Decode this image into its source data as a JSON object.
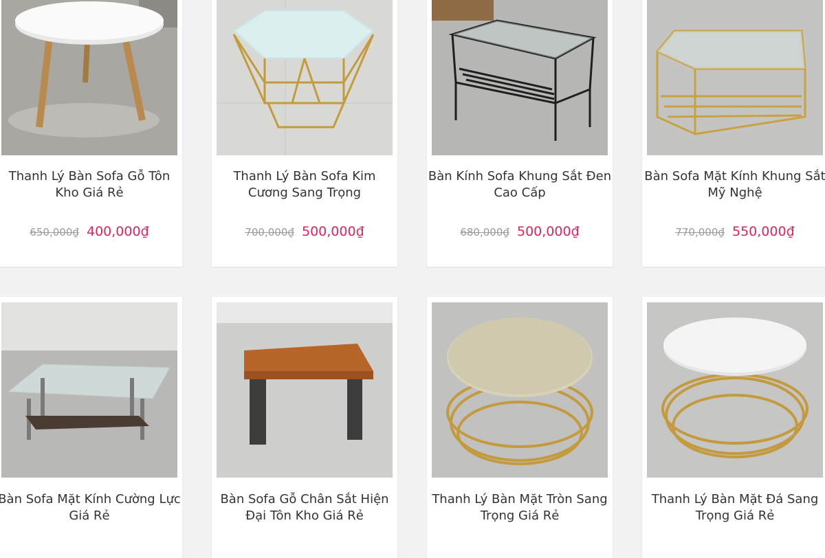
{
  "products": [
    {
      "name": "Thanh Lý Bàn Sofa Gỗ Tôn Kho Giá Rẻ",
      "old_price": "650,000₫",
      "price": "400,000₫",
      "image": "white-round-wooden-leg-table"
    },
    {
      "name": "Thanh Lý Bàn Sofa Kim Cương Sang Trọng",
      "old_price": "700,000₫",
      "price": "500,000₫",
      "image": "octagon-glass-gold-frame-table"
    },
    {
      "name": "Bàn Kính Sofa Khung Sắt Đen Cao Cấp",
      "old_price": "680,000₫",
      "price": "500,000₫",
      "image": "glass-black-iron-frame-table"
    },
    {
      "name": "Bàn Sofa Mặt Kính Khung Sắt Mỹ Nghệ",
      "old_price": "770,000₫",
      "price": "550,000₫",
      "image": "glass-gold-iron-frame-table"
    },
    {
      "name": "Bàn Sofa Mặt Kính Cường Lực Giá Rẻ",
      "image": "tempered-glass-steel-leg-table"
    },
    {
      "name": "Bàn Sofa Gỗ Chân Sắt Hiện Đại Tôn Kho Giá Rẻ",
      "image": "wood-top-iron-leg-table"
    },
    {
      "name": "Thanh Lý Bàn Mặt Tròn Sang Trọng Giá Rẻ",
      "image": "round-marble-gold-ring-table"
    },
    {
      "name": "Thanh Lý Bàn Mặt Đá Sang Trọng Giá Rẻ",
      "image": "round-white-stone-gold-ring-table"
    }
  ],
  "colors": {
    "price": "#e0245e",
    "old_price": "#9a9a9a",
    "title": "#333333",
    "background": "#f2f2f2"
  }
}
